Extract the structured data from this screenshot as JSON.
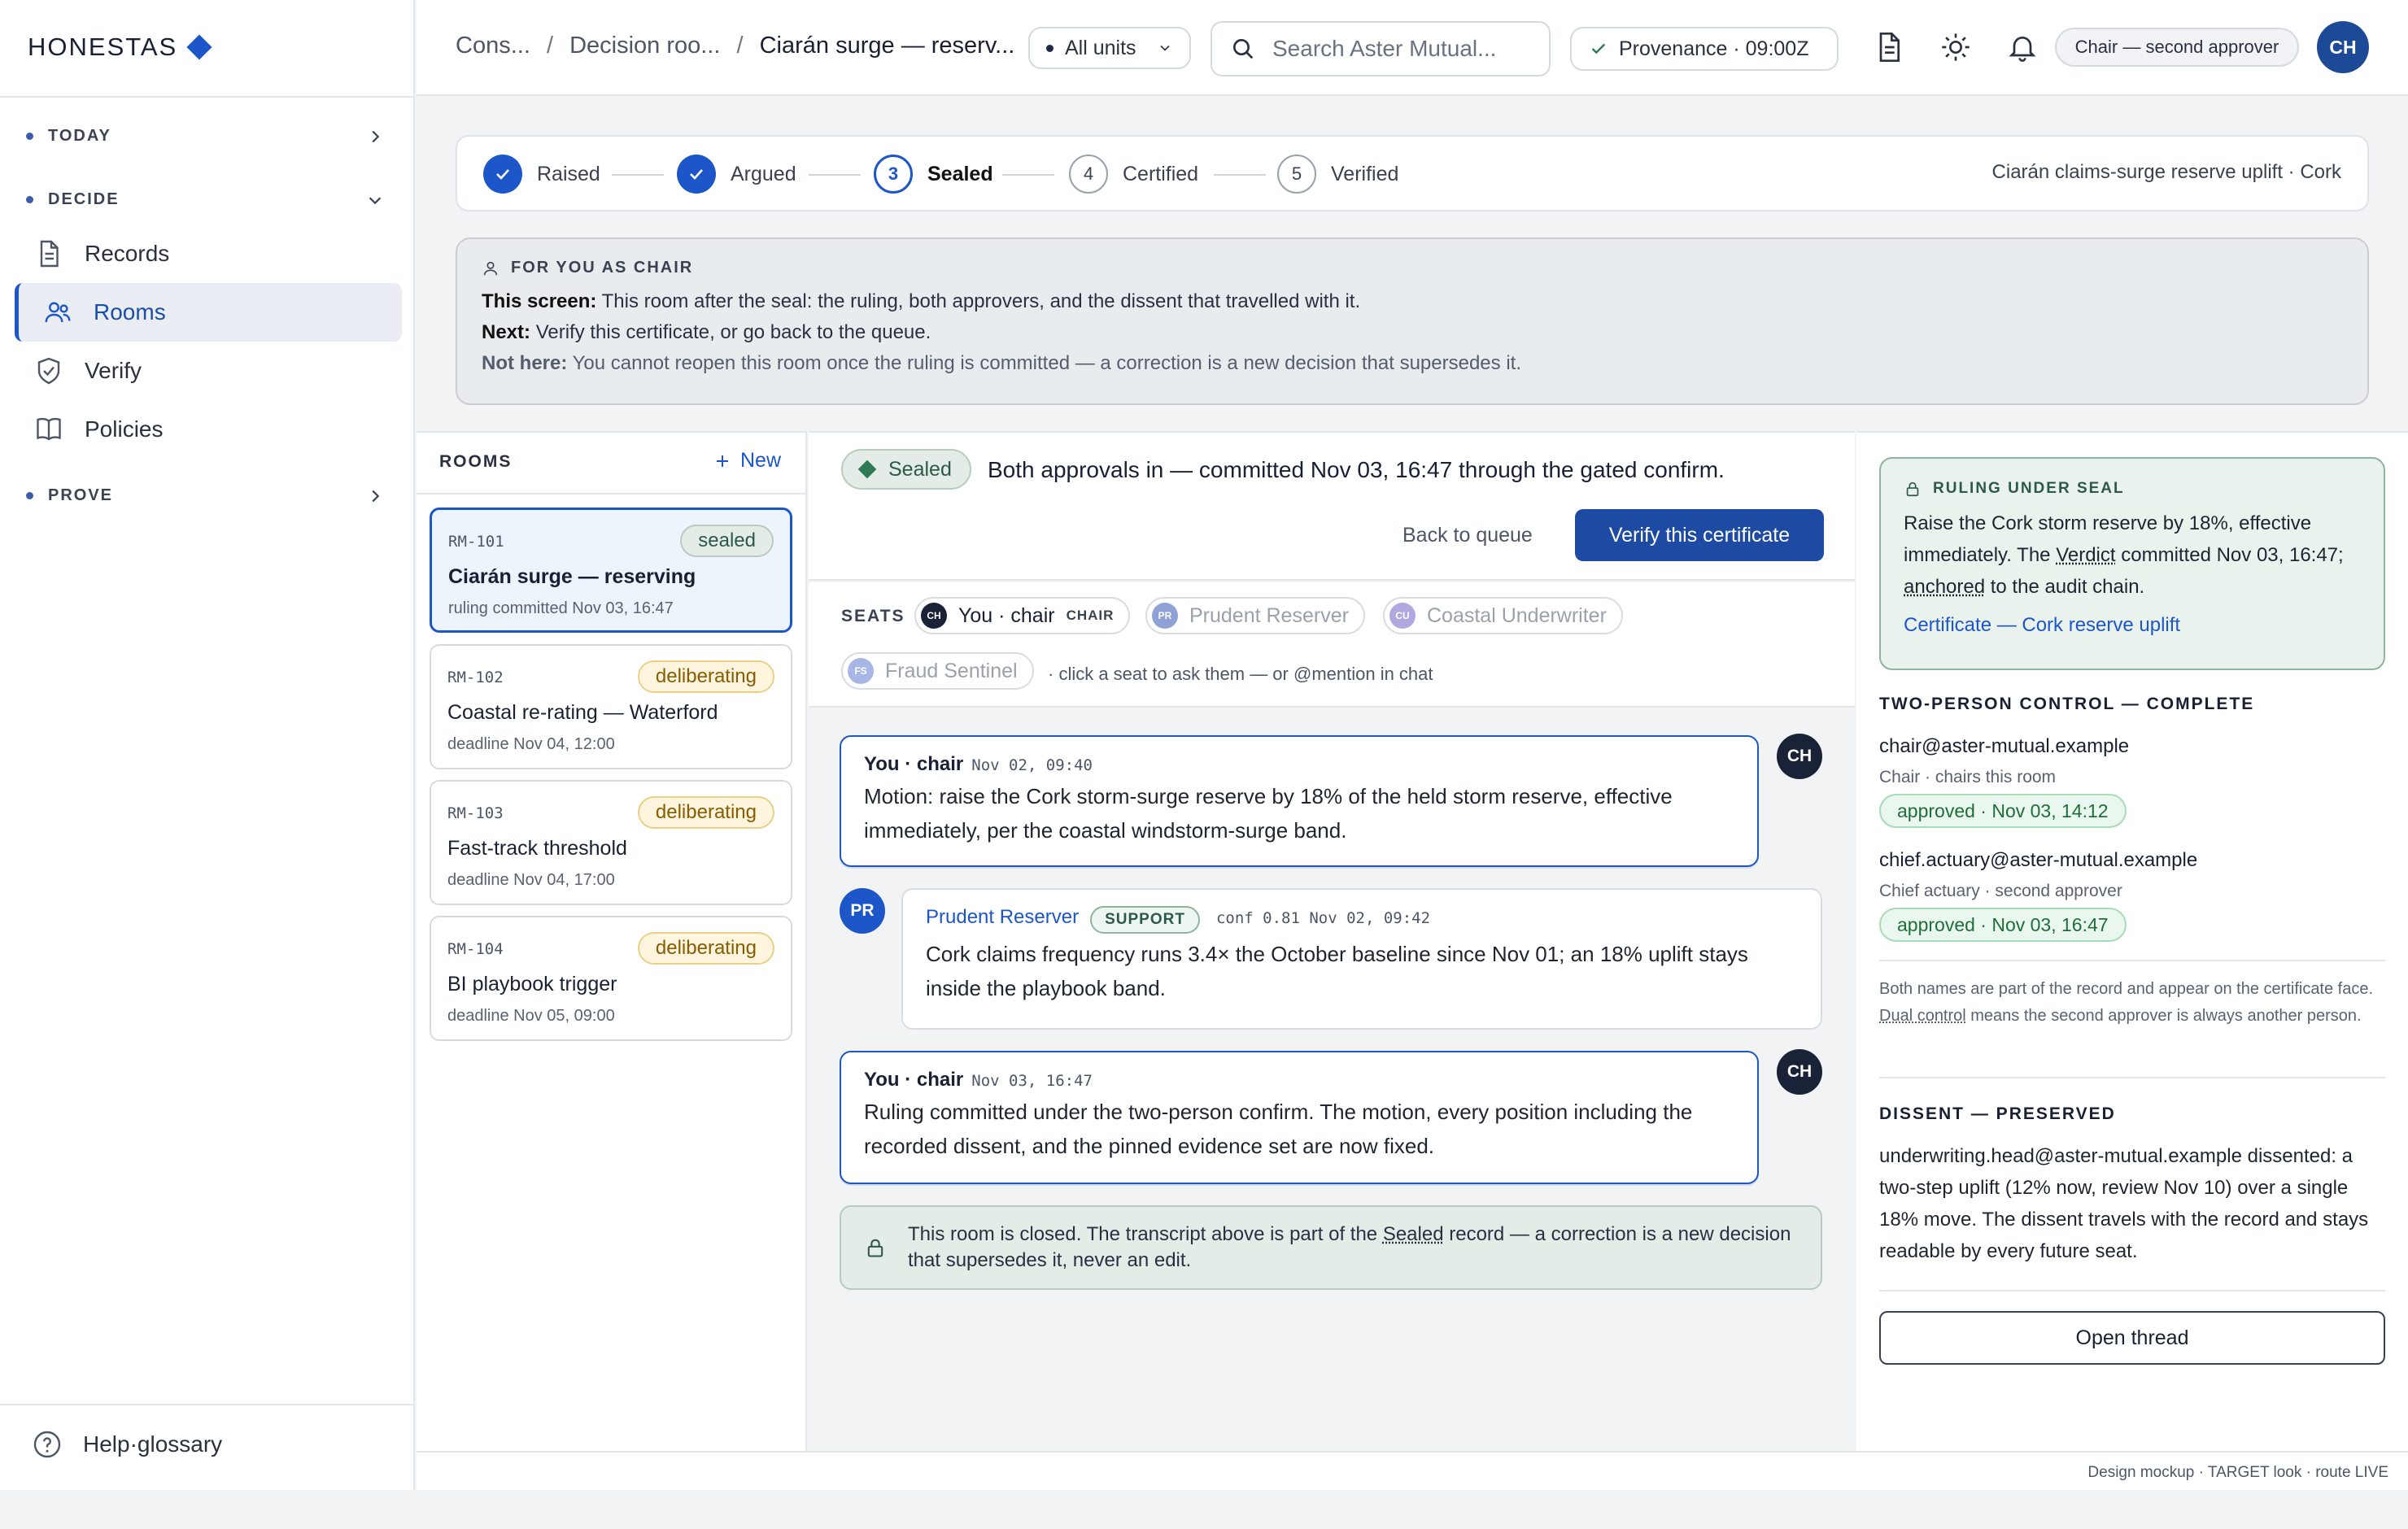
{
  "brand": {
    "name": "HONESTAS"
  },
  "sidebar": {
    "groups": {
      "today": "TODAY",
      "decide": "DECIDE",
      "prove": "PROVE"
    },
    "items": [
      {
        "label": "Records",
        "icon": "document-icon"
      },
      {
        "label": "Rooms",
        "icon": "people-icon"
      },
      {
        "label": "Verify",
        "icon": "shield-check-icon"
      },
      {
        "label": "Policies",
        "icon": "book-icon"
      }
    ],
    "help": "Help·glossary"
  },
  "topbar": {
    "breadcrumbs": [
      "Cons...",
      "Decision roo...",
      "Ciarán surge — reserv..."
    ],
    "units": "All units",
    "search_placeholder": "Search Aster Mutual...",
    "provenance": "Provenance · 09:00Z",
    "role": "Chair — second approver",
    "avatar": "CH"
  },
  "stepper": {
    "steps": [
      {
        "label": "Raised",
        "num": "",
        "state": "done"
      },
      {
        "label": "Argued",
        "num": "",
        "state": "done"
      },
      {
        "label": "Sealed",
        "num": "3",
        "state": "current"
      },
      {
        "label": "Certified",
        "num": "4",
        "state": "todo"
      },
      {
        "label": "Verified",
        "num": "5",
        "state": "todo"
      }
    ],
    "context": "Ciarán claims-surge reserve uplift · Cork"
  },
  "for_you": {
    "heading": "FOR YOU AS CHAIR",
    "screen_label": "This screen:",
    "screen_text": "This room after the seal: the ruling, both approvers, and the dissent that travelled with it.",
    "next_label": "Next:",
    "next_text": "Verify this certificate, or go back to the queue.",
    "not_label": "Not here:",
    "not_text": "You cannot reopen this room once the ruling is committed — a correction is a new decision that supersedes it."
  },
  "rooms": {
    "heading": "ROOMS",
    "new_label": "New",
    "items": [
      {
        "id": "RM-101",
        "status": "sealed",
        "title": "Ciarán surge — reserving",
        "sub": "ruling committed Nov 03, 16:47"
      },
      {
        "id": "RM-102",
        "status": "deliberating",
        "title": "Coastal re-rating — Waterford",
        "sub": "deadline Nov 04, 12:00"
      },
      {
        "id": "RM-103",
        "status": "deliberating",
        "title": "Fast-track threshold",
        "sub": "deadline Nov 04, 17:00"
      },
      {
        "id": "RM-104",
        "status": "deliberating",
        "title": "BI playbook trigger",
        "sub": "deadline Nov 05, 09:00"
      }
    ]
  },
  "center": {
    "sealed_pill": "Sealed",
    "summary": "Both approvals in — committed Nov 03, 16:47 through the gated confirm.",
    "back_label": "Back to queue",
    "verify_label": "Verify this certificate",
    "seats_label": "SEATS",
    "seats": [
      {
        "initials": "CH",
        "name": "You · chair",
        "tag": "CHAIR",
        "color": "#1a2238"
      },
      {
        "initials": "PR",
        "name": "Prudent Reserver",
        "tag": "",
        "color": "#8fa2d6"
      },
      {
        "initials": "CU",
        "name": "Coastal Underwriter",
        "tag": "",
        "color": "#b2a8e0"
      },
      {
        "initials": "FS",
        "name": "Fraud Sentinel",
        "tag": "",
        "color": "#a8b6e6"
      }
    ],
    "seats_hint": "· click a seat to ask them — or @mention in chat",
    "messages": [
      {
        "who": "You · chair",
        "time": "Nov 02, 09:40",
        "avatar": "CH",
        "body": "Motion: raise the Cork storm-surge reserve by 18% of the held storm reserve, effective immediately, per the coastal windstorm-surge band."
      },
      {
        "who": "Prudent Reserver",
        "badge": "SUPPORT",
        "time": "conf 0.81  Nov 02, 09:42",
        "avatar": "PR",
        "body": "Cork claims frequency runs 3.4× the October baseline since Nov 01; an 18% uplift stays inside the playbook band."
      },
      {
        "who": "You · chair",
        "time": "Nov 03, 16:47",
        "avatar": "CH",
        "body": "Ruling committed under the two-person confirm. The motion, every position including the recorded dissent, and the pinned evidence set are now fixed."
      }
    ],
    "closed_pre": "This room is closed. The transcript above is part of the ",
    "closed_link": "Sealed",
    "closed_post": " record — a correction is a new decision that supersedes it, never an edit."
  },
  "right": {
    "ruling_heading": "RULING UNDER SEAL",
    "ruling_pre": "Raise the Cork storm reserve by 18%, effective immediately. The ",
    "ruling_verdict": "Verdict",
    "ruling_mid": " committed Nov 03, 16:47; ",
    "ruling_anchored": "anchored",
    "ruling_post": " to the audit chain.",
    "certificate_link": "Certificate — Cork reserve uplift",
    "tpc_heading": "TWO-PERSON CONTROL — COMPLETE",
    "approvers": [
      {
        "email": "chair@aster-mutual.example",
        "role": "Chair · chairs this room",
        "status": "approved · Nov 03, 14:12"
      },
      {
        "email": "chief.actuary@aster-mutual.example",
        "role": "Chief actuary · second approver",
        "status": "approved · Nov 03, 16:47"
      }
    ],
    "note_pre": "Both names are part of the record and appear on the certificate face. ",
    "note_link": "Dual control",
    "note_post": " means the second approver is always another person.",
    "dissent_heading": "DISSENT — PRESERVED",
    "dissent_text": "underwriting.head@aster-mutual.example dissented: a two-step uplift (12% now, review Nov 10) over a single 18% move. The dissent travels with the record and stays readable by every future seat.",
    "open_thread": "Open thread"
  },
  "footer": {
    "text": "Design mockup · TARGET look · route LIVE"
  },
  "colors": {
    "accent": "#1d56c8",
    "sealed": "#2f7a55",
    "deliberating": "#8a5b00"
  }
}
